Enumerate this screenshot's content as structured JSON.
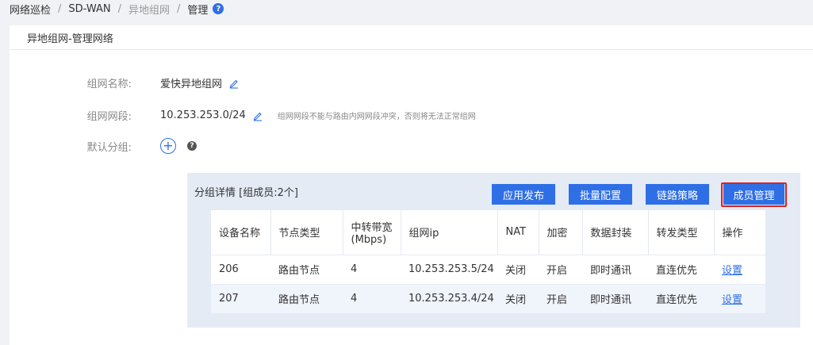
{
  "breadcrumb": {
    "items": [
      "网络巡检",
      "SD-WAN",
      "异地组网",
      "管理"
    ],
    "help": "?"
  },
  "card": {
    "title": "异地组网-管理网络"
  },
  "form": {
    "name_label": "组网名称:",
    "name_value": "爱快异地组网",
    "segment_label": "组网网段:",
    "segment_value": "10.253.253.0/24",
    "segment_hint": "组网网段不能与路由内网网段冲突，否则将无法正常组网",
    "default_group_label": "默认分组:",
    "add_symbol": "+",
    "help_symbol": "?"
  },
  "group": {
    "title": "分组详情 [组成员:2个]",
    "buttons": {
      "publish": "应用发布",
      "batch_config": "批量配置",
      "link_policy": "链路策略",
      "member_manage": "成员管理"
    },
    "table": {
      "headers": [
        "设备名称",
        "节点类型",
        "中转带宽\n(Mbps)",
        "组网ip",
        "NAT",
        "加密",
        "数据封装",
        "转发类型",
        "操作"
      ],
      "header_bw_line1": "中转带宽",
      "header_bw_line2": "(Mbps)",
      "rows": [
        [
          "206",
          "路由节点",
          "4",
          "10.253.253.5/24",
          "关闭",
          "开启",
          "即时通讯",
          "直连优先",
          "设置"
        ],
        [
          "207",
          "路由节点",
          "4",
          "10.253.253.4/24",
          "关闭",
          "开启",
          "即时通讯",
          "直连优先",
          "设置"
        ]
      ]
    }
  },
  "colors": {
    "accent": "#2f6fe6",
    "highlight": "#e02020",
    "panel_bg": "#e4ebf5"
  },
  "icons": {
    "edit": "pencil-icon",
    "add": "plus-circle-icon",
    "help": "question-icon"
  }
}
